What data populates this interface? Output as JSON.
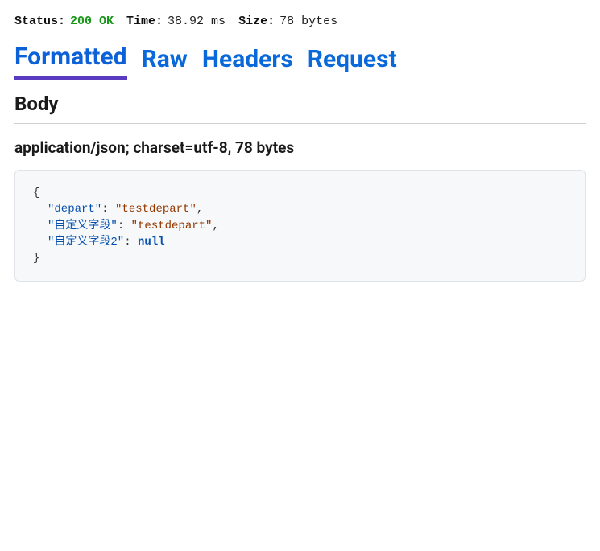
{
  "status_bar": {
    "status_label": "Status:",
    "status_value": "200 OK",
    "time_label": "Time:",
    "time_value": "38.92 ms",
    "size_label": "Size:",
    "size_value": "78 bytes"
  },
  "tabs": {
    "formatted": "Formatted",
    "raw": "Raw",
    "headers": "Headers",
    "request": "Request",
    "active": "formatted"
  },
  "body": {
    "section_title": "Body",
    "content_type_line": "application/json; charset=utf-8, 78 bytes",
    "json": {
      "line1_key": "\"depart\"",
      "line1_val": "\"testdepart\"",
      "line2_key": "\"自定义字段\"",
      "line2_val": "\"testdepart\"",
      "line3_key": "\"自定义字段2\"",
      "line3_val": "null"
    }
  }
}
